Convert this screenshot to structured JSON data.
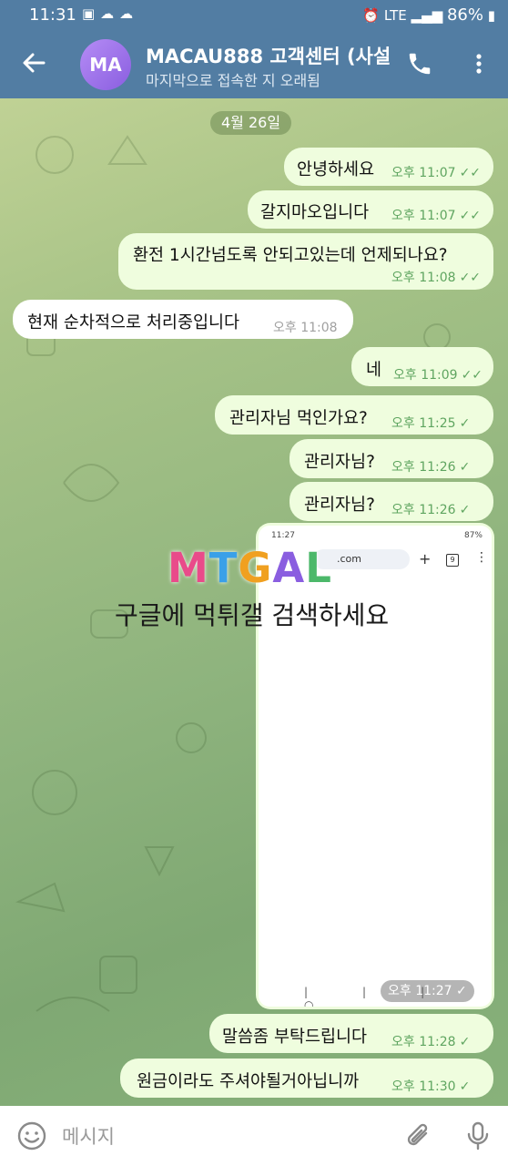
{
  "status_bar": {
    "time": "11:31",
    "network": "LTE",
    "battery": "86%"
  },
  "header": {
    "back_icon": "arrow-left-icon",
    "avatar_initials": "MA",
    "title": "MACAU888 고객센터 (사설",
    "subtitle": "마지막으로 접속한 지 오래됨"
  },
  "date_separator": "4월 26일",
  "messages": [
    {
      "dir": "out",
      "text": "안녕하세요",
      "time": "오후 11:07",
      "read": "✓✓"
    },
    {
      "dir": "out",
      "text": "갈지마오입니다",
      "time": "오후 11:07",
      "read": "✓✓"
    },
    {
      "dir": "out",
      "text": "환전 1시간넘도록 안되고있는데 언제되나요?",
      "time": "오후 11:08",
      "read": "✓✓"
    },
    {
      "dir": "in",
      "text": "현재 순차적으로 처리중입니다",
      "time": "오후 11:08"
    },
    {
      "dir": "out",
      "text": "네",
      "time": "오후 11:09",
      "read": "✓✓"
    },
    {
      "dir": "out",
      "text": "관리자님 먹인가요?",
      "time": "오후 11:25",
      "read": "✓"
    },
    {
      "dir": "out",
      "text": "관리자님?",
      "time": "오후 11:26",
      "read": "✓"
    },
    {
      "dir": "out",
      "text": "관리자님?",
      "time": "오후 11:26",
      "read": "✓"
    },
    {
      "dir": "out",
      "text": "말씀좀 부탁드립니다",
      "time": "오후 11:28",
      "read": "✓"
    },
    {
      "dir": "out",
      "text": "원금이라도 주셔야될거아닙니까",
      "time": "오후 11:30",
      "read": "✓"
    }
  ],
  "image_message": {
    "time": "오후 11:27",
    "read": "✓",
    "screenshot": {
      "status_time": "11:27",
      "status_right": "87%",
      "url_text": ".com",
      "tab_count": "9"
    }
  },
  "watermark": {
    "logo": "MTGAL",
    "line": "구글에 먹튀갤 검색하세요",
    "colors": [
      "#e94b8a",
      "#3aa0e8",
      "#f0a020",
      "#8a5ee0",
      "#4cb86a"
    ]
  },
  "input": {
    "placeholder": "메시지"
  },
  "colors": {
    "header": "#527da3",
    "outgoing": "#effdde",
    "incoming": "#ffffff",
    "accent": "#5fa560"
  }
}
